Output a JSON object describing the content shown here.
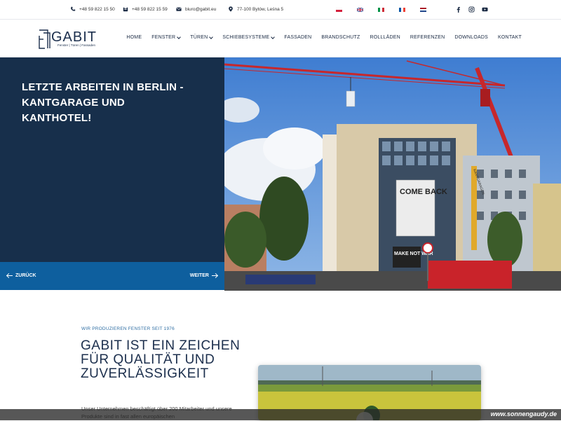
{
  "topbar": {
    "phone1": "+48 59 822 15 50",
    "phone2": "+48 59 822 15 59",
    "email": "biuro@gabit.eu",
    "address": "77-100 Bytów, Leśna 5",
    "languages": [
      "pl",
      "en",
      "it",
      "fr",
      "nl"
    ],
    "social": [
      "facebook",
      "instagram",
      "youtube"
    ]
  },
  "logo": {
    "name": "GABIT",
    "tagline": "Fenster | Türen | Fassaden"
  },
  "menu": [
    {
      "label": "HOME"
    },
    {
      "label": "FENSTER"
    },
    {
      "label": "TÜREN"
    },
    {
      "label": "SCHIEBESYSTEME"
    },
    {
      "label": "FASSADEN"
    },
    {
      "label": "BRANDSCHUTZ"
    },
    {
      "label": "ROLLLÄDEN"
    },
    {
      "label": "REFERENZEN"
    },
    {
      "label": "DOWNLOADS"
    },
    {
      "label": "KONTAKT"
    }
  ],
  "hero": {
    "title": "LETZTE ARBEITEN IN BERLIN - KANTGARAGE UND KANTHOTEL!",
    "prev_label": "ZURÜCK",
    "next_label": "WEITER",
    "banner_line1": "COME BACK",
    "banner_line2": "MAKE NOT WAR",
    "crane_text": "KANTGARAGEN"
  },
  "section": {
    "eyebrow": "WIR PRODUZIEREN FENSTER SEIT 1976",
    "headline": "GABIT IST EIN ZEICHEN FÜR QUALITÄT UND ZUVERLÄSSIGKEIT",
    "body": "Unser Unternehmen beschäftigt über 200 Mitarbeiter und unsere Produkte sind in fast allen europäischen"
  },
  "watermark": "www.sonnengaudy.de",
  "colors": {
    "navy": "#172f4b",
    "blue": "#0e5f9e",
    "accent": "#2f6ea3"
  }
}
